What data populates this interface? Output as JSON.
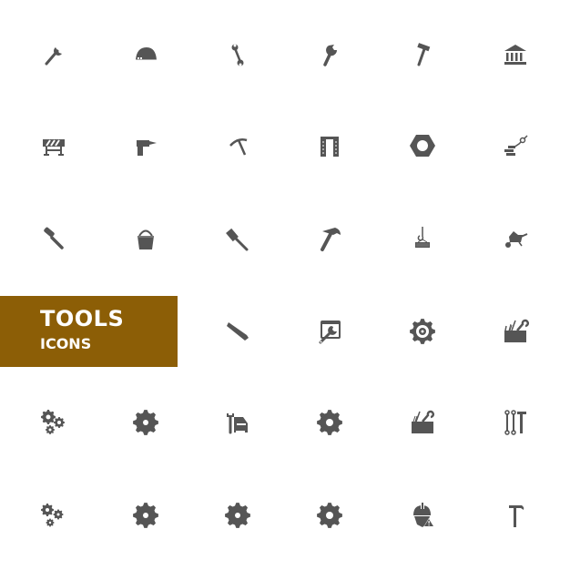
{
  "banner": {
    "title": "TOOLS",
    "subtitle": "ICONS",
    "color": "#8c5e06"
  },
  "icon_color": "#555555",
  "icons": [
    [
      "adjustable-wrench-icon",
      "hard-hat-icon",
      "double-wrench-icon",
      "wrench-icon",
      "hammer-icon",
      "bank-building-icon"
    ],
    [
      "road-barrier-icon",
      "power-drill-icon",
      "pickaxe-icon",
      "door-frame-icon",
      "hex-nut-icon",
      "brick-trowel-icon"
    ],
    [
      "paint-roller-icon",
      "bucket-icon",
      "sledgehammer-icon",
      "claw-hammer-icon",
      "crane-hook-load-icon",
      "wheelbarrow-icon"
    ],
    [
      "",
      "",
      "hand-saw-icon",
      "wrench-window-icon",
      "gear-outline-icon",
      "toolbox-icon"
    ],
    [
      "gears-icon",
      "gear-icon",
      "car-repair-icon",
      "gear-solid-icon",
      "toolbox-open-icon",
      "wrenches-hammer-icon"
    ],
    [
      "gears-small-icon",
      "gear-icon",
      "gear-icon",
      "gear-solid-icon",
      "worker-warning-icon",
      "hammer-thin-icon"
    ]
  ]
}
